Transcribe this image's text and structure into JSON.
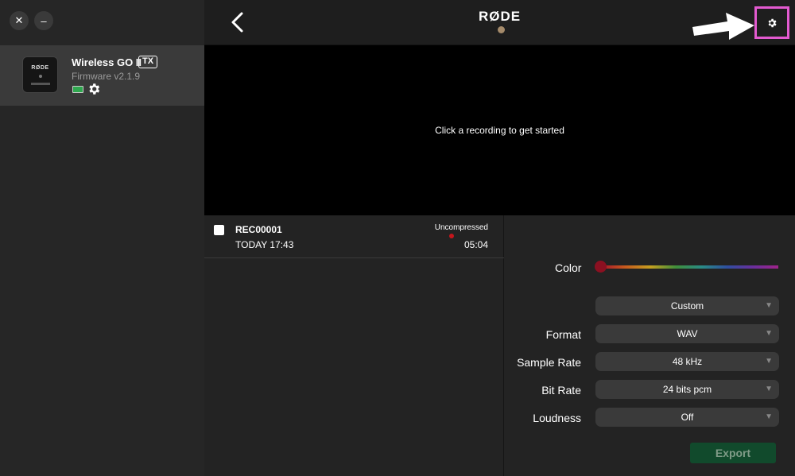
{
  "window": {
    "close_label": "✕",
    "minimize_label": "–"
  },
  "device": {
    "name": "Wireless GO II",
    "badge": "TX",
    "firmware": "Firmware v2.1.9",
    "thumb_logo": "RØDE",
    "battery_color": "#2fa84f"
  },
  "header": {
    "logo": "RØDE",
    "back_icon": "chevron-left-icon",
    "settings_icon": "gear-icon",
    "highlight_color": "#e35ad0"
  },
  "preview": {
    "message": "Click a recording to get started"
  },
  "recordings": [
    {
      "name": "REC00001",
      "date": "TODAY 17:43",
      "format": "Uncompressed",
      "duration": "05:04"
    }
  ],
  "export": {
    "color_label": "Color",
    "preset": "Custom",
    "format_label": "Format",
    "format_value": "WAV",
    "sample_rate_label": "Sample Rate",
    "sample_rate_value": "48 kHz",
    "bit_rate_label": "Bit Rate",
    "bit_rate_value": "24 bits pcm",
    "loudness_label": "Loudness",
    "loudness_value": "Off",
    "export_label": "Export",
    "export_color": "#114a2c"
  }
}
